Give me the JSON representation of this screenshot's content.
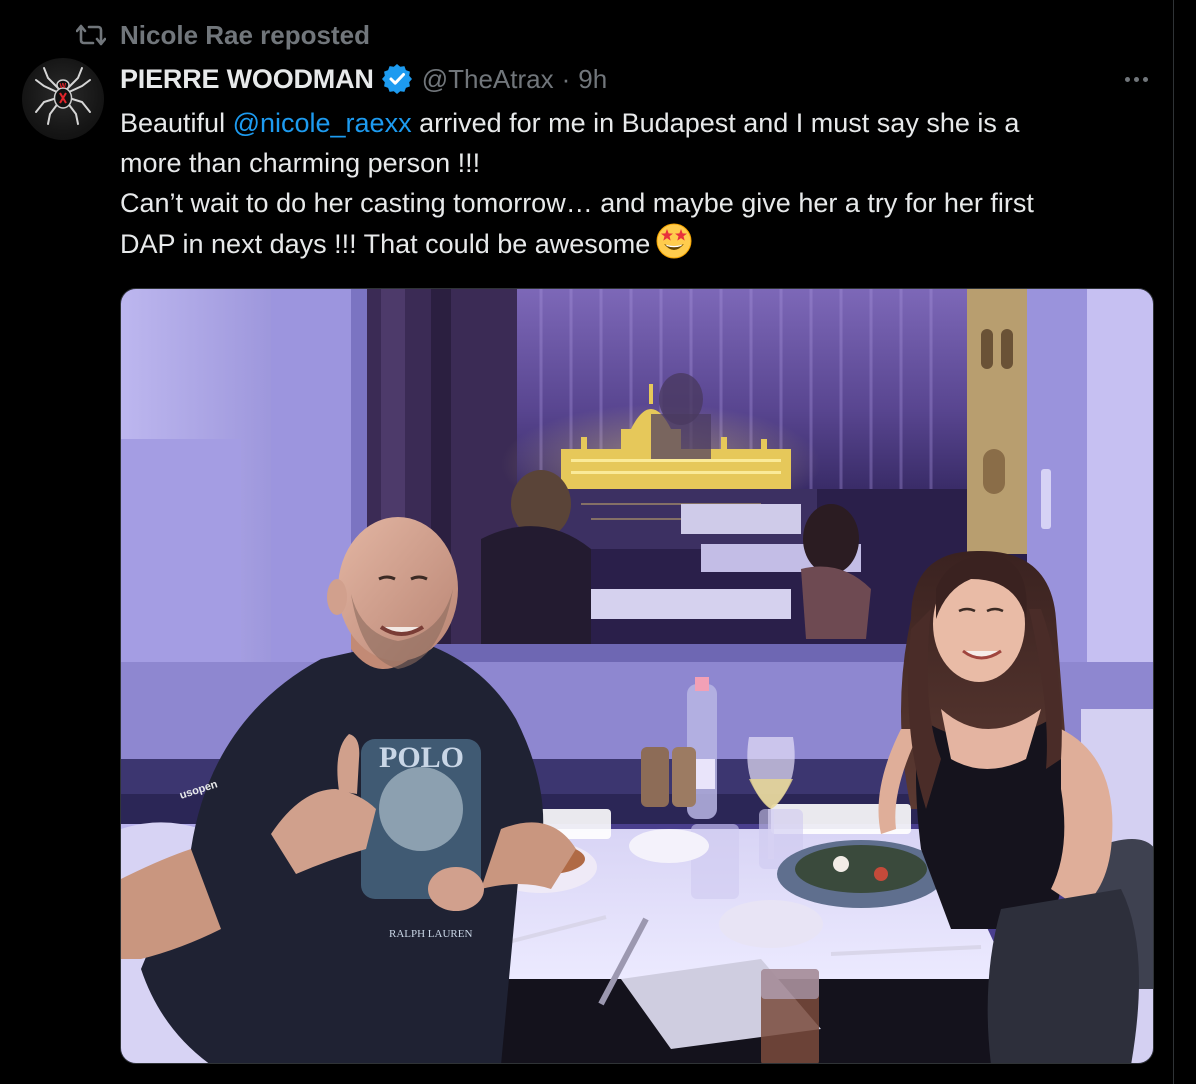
{
  "repost": {
    "icon": "repost-icon",
    "text": "Nicole Rae reposted"
  },
  "author": {
    "avatar_icon": "spider-logo-avatar",
    "display_name": "PIERRE WOODMAN",
    "verified_icon": "verified-badge-icon",
    "handle": "@TheAtrax",
    "separator": "·",
    "time": "9h"
  },
  "more_icon": "more-options-icon",
  "tweet": {
    "line1_before": "Beautiful ",
    "line1_mention": "@nicole_raexx",
    "line1_after": " arrived for me in Budapest and I must say she is a",
    "line2": "more than charming person !!!",
    "line3": "Can’t wait to do her casting tomorrow… and maybe give her a try for her first",
    "line4": "DAP in next days !!! That could be awesome",
    "emoji": "star-struck-emoji"
  },
  "media": {
    "type": "photo",
    "description_icon": "restaurant-photo",
    "shirt_text_1": "POLO",
    "shirt_text_2": "RALPH LAUREN",
    "sleeve_text": "usopen"
  },
  "colors": {
    "background": "#000000",
    "text_primary": "#e7e9ea",
    "text_secondary": "#71767b",
    "link": "#1d9bf0",
    "verified": "#1d9bf0"
  }
}
